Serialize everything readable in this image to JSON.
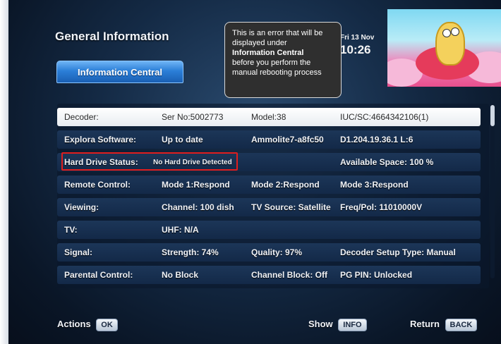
{
  "header": {
    "title": "General Information",
    "active_tab": "Information Central",
    "date": "Fri 13 Nov",
    "time": "10:26"
  },
  "callout": {
    "line1": "This is an error that will be displayed under",
    "line2": "Information Central",
    "line3": "before you perform the manual rebooting process"
  },
  "rows": [
    {
      "c0": "Decoder:",
      "c1": "Ser No:5002773",
      "c2": "Model:38",
      "c3": "IUC/SC:4664342106(1)"
    },
    {
      "c0": "Explora Software:",
      "c1": "Up to date",
      "c2": "Ammolite7-a8fc50",
      "c3": "D1.204.19.36.1 L:6"
    },
    {
      "c0": "Hard Drive Status:",
      "c1": "No Hard Drive Detected",
      "c2": "",
      "c3": "Available Space: 100 %"
    },
    {
      "c0": "Remote Control:",
      "c1": "Mode 1:Respond",
      "c2": "Mode 2:Respond",
      "c3": "Mode 3:Respond"
    },
    {
      "c0": "Viewing:",
      "c1": "Channel: 100 dish",
      "c2": "TV Source: Satellite",
      "c3": "Freq/Pol: 11010000V"
    },
    {
      "c0": "TV:",
      "c1": "UHF: N/A",
      "c2": "",
      "c3": ""
    },
    {
      "c0": "Signal:",
      "c1": "Strength: 74%",
      "c2": "Quality: 97%",
      "c3": "Decoder Setup Type: Manual"
    },
    {
      "c0": "Parental Control:",
      "c1": "No Block",
      "c2": "Channel Block: Off",
      "c3": "PG PIN: Unlocked"
    }
  ],
  "footer": {
    "actions_label": "Actions",
    "actions_key": "OK",
    "show_label": "Show",
    "show_key": "INFO",
    "return_label": "Return",
    "return_key": "BACK"
  },
  "colors": {
    "error_outline": "#e01d1d",
    "tab_blue": "#2b7fd8",
    "background": "#142a45"
  }
}
